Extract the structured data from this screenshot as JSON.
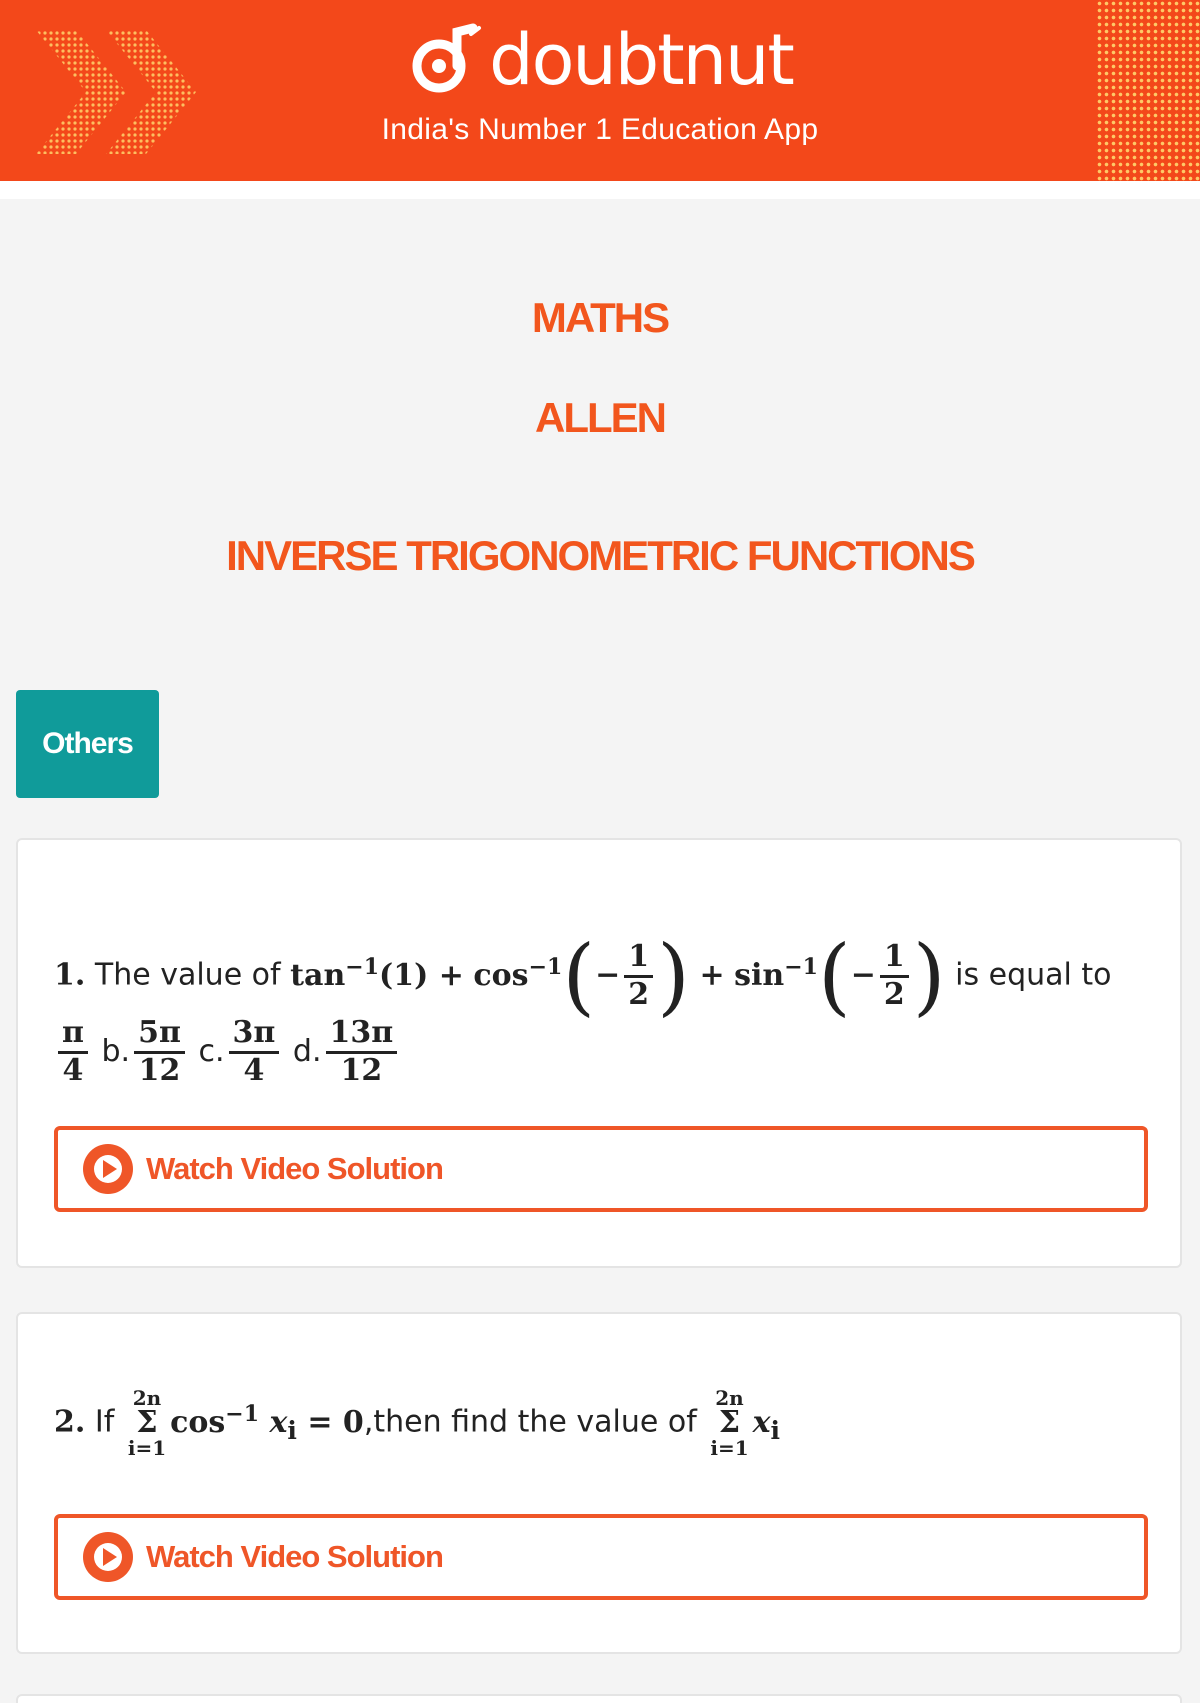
{
  "header": {
    "brand": "doubtnut",
    "tagline": "India's Number 1 Education App",
    "colors": {
      "background": "#f3481a",
      "text": "#ffffff"
    }
  },
  "titles": {
    "subject": "MATHS",
    "publisher": "ALLEN",
    "chapter": "INVERSE TRIGONOMETRIC FUNCTIONS"
  },
  "category_tag": "Others",
  "questions": [
    {
      "number": "1.",
      "text_intro": "The value of",
      "t1": "tan",
      "t1_exp": "−1",
      "t1_arg": "(1) +",
      "t2": "cos",
      "t2_exp": "−1",
      "minus": "−",
      "num": "1",
      "den": "2",
      "plus": "+",
      "t3": "sin",
      "t3_exp": "−1",
      "text_tail": "is equal to",
      "options": [
        {
          "label": "",
          "num": "π",
          "den": "4"
        },
        {
          "label": "b.",
          "num": "5π",
          "den": "12"
        },
        {
          "label": "c.",
          "num": "3π",
          "den": "4"
        },
        {
          "label": "d.",
          "num": "13π",
          "den": "12"
        }
      ],
      "button": "Watch Video Solution"
    },
    {
      "number": "2.",
      "if": "If",
      "sum_upper": "2n",
      "sum_sigma": "Σ",
      "sum_lower": "i=1",
      "expr": "cos",
      "expr_exp": "−1",
      "expr_tail": "x",
      "expr_sub": "i",
      "eq": "= 0",
      "text_mid": ",then find the value of",
      "sum2_upper": "2n",
      "sum2_sigma": "Σ",
      "sum2_lower": "i=1",
      "tail_var": "x",
      "tail_sub": "i",
      "button": "Watch Video Solution"
    }
  ],
  "colors": {
    "accent": "#f2561d",
    "tag": "#109b9a",
    "button_border": "#ef5628"
  },
  "icons": {
    "play": "play-circle-icon",
    "logo": "doubtnut-logo-icon"
  }
}
